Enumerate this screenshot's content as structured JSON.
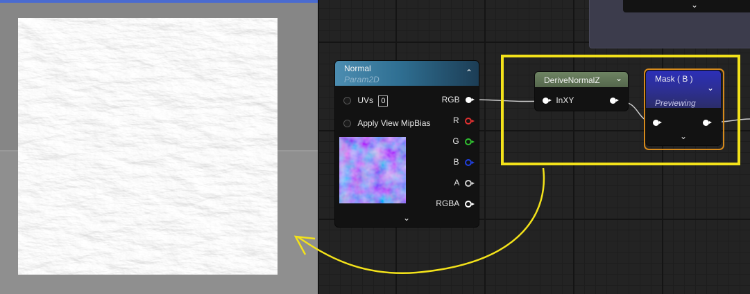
{
  "viewport": {
    "floor_color": "#8f8f8f",
    "accent_bar_color": "#4a6bd0"
  },
  "graph": {
    "nodes": {
      "normal": {
        "title": "Normal",
        "subtitle": "Param2D",
        "inputs": [
          {
            "label": "UVs",
            "value": "0"
          },
          {
            "label": "Apply View MipBias"
          }
        ],
        "outputs": [
          "RGB",
          "R",
          "G",
          "B",
          "A",
          "RGBA"
        ]
      },
      "derive": {
        "title": "DeriveNormalZ",
        "input": "InXY"
      },
      "mask": {
        "title": "Mask ( B )",
        "subtitle": "Previewing"
      }
    }
  },
  "annotations": {
    "color": "#f3e21a"
  },
  "colors": {
    "selection_orange": "#d68a1c",
    "normal_header": "#2f6f92",
    "derive_header": "#6e8463",
    "mask_header": "#2c2fb8"
  }
}
